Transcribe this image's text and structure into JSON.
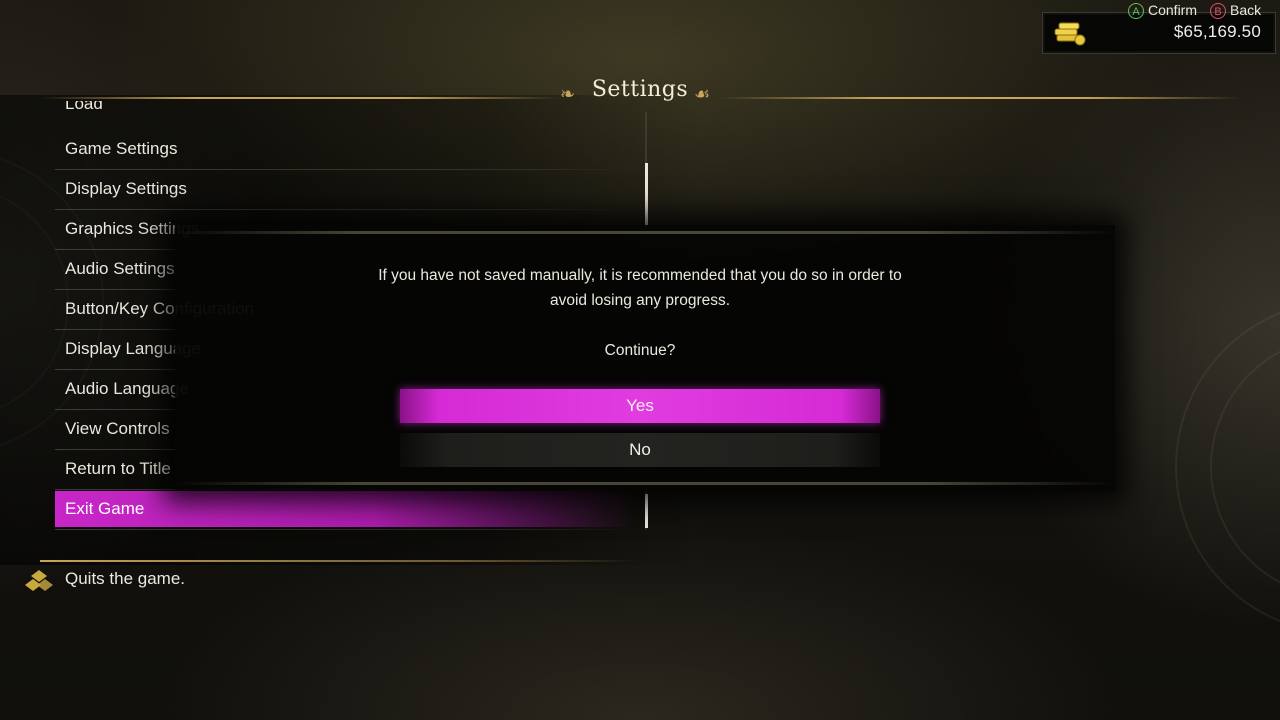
{
  "hud": {
    "money": "$65,169.50",
    "money_icon": "gold-coins-icon"
  },
  "settings": {
    "title": "Settings",
    "menu_items": [
      {
        "label": "Load"
      },
      {
        "label": "Game Settings"
      },
      {
        "label": "Display Settings"
      },
      {
        "label": "Graphics Settings"
      },
      {
        "label": "Audio Settings"
      },
      {
        "label": "Button/Key Configuration"
      },
      {
        "label": "Display Language"
      },
      {
        "label": "Audio Language"
      },
      {
        "label": "View Controls"
      },
      {
        "label": "Return to Title"
      },
      {
        "label": "Exit Game"
      }
    ],
    "selected_item": "Exit Game",
    "description": "Quits the game.",
    "description_icon": "diamond-icon"
  },
  "dialog": {
    "message_line1": "If you have not saved manually, it is recommended that you do so in order to",
    "message_line2": "avoid losing any progress.",
    "question": "Continue?",
    "yes_label": "Yes",
    "no_label": "No",
    "selected": "Yes"
  },
  "controls": {
    "confirm_glyph": "A",
    "confirm_label": "Confirm",
    "back_glyph": "B",
    "back_label": "Back"
  },
  "colors": {
    "highlight": "#d52ad5",
    "gold": "#c7a55a",
    "confirm": "#5cc45c",
    "back": "#e0506a"
  }
}
